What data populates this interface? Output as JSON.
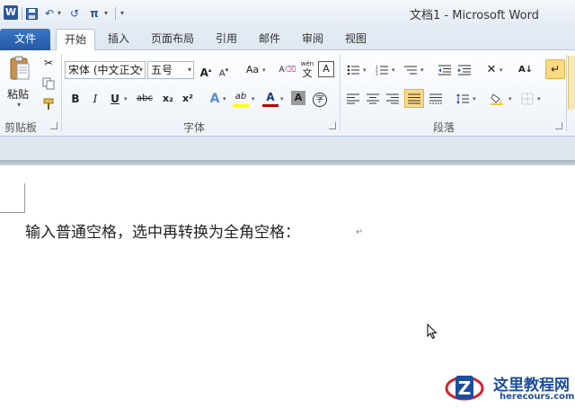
{
  "titlebar": {
    "app_letter": "W",
    "doc_title": "文档1 - Microsoft Word",
    "qat": {
      "undo_glyph": "↶",
      "redo_glyph": "↺",
      "pi_glyph": "π"
    }
  },
  "tabs": [
    {
      "label": "文件"
    },
    {
      "label": "开始"
    },
    {
      "label": "插入"
    },
    {
      "label": "页面布局"
    },
    {
      "label": "引用"
    },
    {
      "label": "邮件"
    },
    {
      "label": "审阅"
    },
    {
      "label": "视图"
    }
  ],
  "active_tab": "开始",
  "ribbon": {
    "clipboard": {
      "paste_label": "粘贴",
      "group_label": "剪贴板"
    },
    "font": {
      "font_name": "宋体 (中文正文",
      "font_size": "五号",
      "group_label": "字体",
      "grow": "A",
      "shrink": "A",
      "case": "Aa",
      "bold": "B",
      "italic": "I",
      "underline": "U",
      "strike": "abc",
      "sub": "x₂",
      "sup": "x²",
      "effects": "A",
      "highlight": "ab",
      "font_color": "A",
      "char_shade": "A",
      "enclose": "字",
      "phonetic": "wén",
      "phonetic_char": "文",
      "border_char": "A"
    },
    "paragraph": {
      "group_label": "段落"
    }
  },
  "colors": {
    "highlight": "#ffff00",
    "font_color": "#c00000",
    "accent": "#2b579a"
  },
  "document": {
    "text": "输入普通空格，选中再转换为全角空格：",
    "para_mark": "↵"
  },
  "watermark": {
    "name": "这里教程网",
    "url": "herecours.com",
    "letter": "Z"
  }
}
